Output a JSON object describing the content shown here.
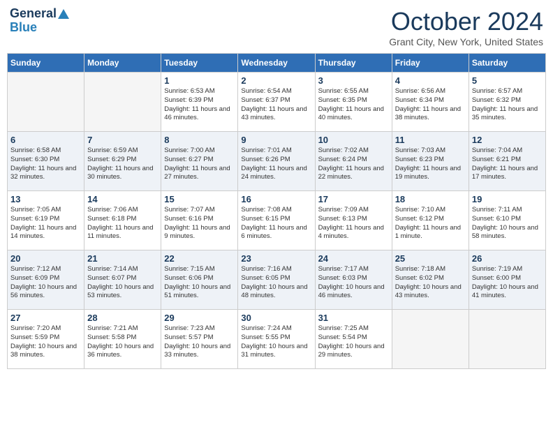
{
  "header": {
    "logo_general": "General",
    "logo_blue": "Blue",
    "month": "October 2024",
    "location": "Grant City, New York, United States"
  },
  "days_of_week": [
    "Sunday",
    "Monday",
    "Tuesday",
    "Wednesday",
    "Thursday",
    "Friday",
    "Saturday"
  ],
  "weeks": [
    [
      {
        "day": "",
        "content": ""
      },
      {
        "day": "",
        "content": ""
      },
      {
        "day": "1",
        "content": "Sunrise: 6:53 AM\nSunset: 6:39 PM\nDaylight: 11 hours and 46 minutes."
      },
      {
        "day": "2",
        "content": "Sunrise: 6:54 AM\nSunset: 6:37 PM\nDaylight: 11 hours and 43 minutes."
      },
      {
        "day": "3",
        "content": "Sunrise: 6:55 AM\nSunset: 6:35 PM\nDaylight: 11 hours and 40 minutes."
      },
      {
        "day": "4",
        "content": "Sunrise: 6:56 AM\nSunset: 6:34 PM\nDaylight: 11 hours and 38 minutes."
      },
      {
        "day": "5",
        "content": "Sunrise: 6:57 AM\nSunset: 6:32 PM\nDaylight: 11 hours and 35 minutes."
      }
    ],
    [
      {
        "day": "6",
        "content": "Sunrise: 6:58 AM\nSunset: 6:30 PM\nDaylight: 11 hours and 32 minutes."
      },
      {
        "day": "7",
        "content": "Sunrise: 6:59 AM\nSunset: 6:29 PM\nDaylight: 11 hours and 30 minutes."
      },
      {
        "day": "8",
        "content": "Sunrise: 7:00 AM\nSunset: 6:27 PM\nDaylight: 11 hours and 27 minutes."
      },
      {
        "day": "9",
        "content": "Sunrise: 7:01 AM\nSunset: 6:26 PM\nDaylight: 11 hours and 24 minutes."
      },
      {
        "day": "10",
        "content": "Sunrise: 7:02 AM\nSunset: 6:24 PM\nDaylight: 11 hours and 22 minutes."
      },
      {
        "day": "11",
        "content": "Sunrise: 7:03 AM\nSunset: 6:23 PM\nDaylight: 11 hours and 19 minutes."
      },
      {
        "day": "12",
        "content": "Sunrise: 7:04 AM\nSunset: 6:21 PM\nDaylight: 11 hours and 17 minutes."
      }
    ],
    [
      {
        "day": "13",
        "content": "Sunrise: 7:05 AM\nSunset: 6:19 PM\nDaylight: 11 hours and 14 minutes."
      },
      {
        "day": "14",
        "content": "Sunrise: 7:06 AM\nSunset: 6:18 PM\nDaylight: 11 hours and 11 minutes."
      },
      {
        "day": "15",
        "content": "Sunrise: 7:07 AM\nSunset: 6:16 PM\nDaylight: 11 hours and 9 minutes."
      },
      {
        "day": "16",
        "content": "Sunrise: 7:08 AM\nSunset: 6:15 PM\nDaylight: 11 hours and 6 minutes."
      },
      {
        "day": "17",
        "content": "Sunrise: 7:09 AM\nSunset: 6:13 PM\nDaylight: 11 hours and 4 minutes."
      },
      {
        "day": "18",
        "content": "Sunrise: 7:10 AM\nSunset: 6:12 PM\nDaylight: 11 hours and 1 minute."
      },
      {
        "day": "19",
        "content": "Sunrise: 7:11 AM\nSunset: 6:10 PM\nDaylight: 10 hours and 58 minutes."
      }
    ],
    [
      {
        "day": "20",
        "content": "Sunrise: 7:12 AM\nSunset: 6:09 PM\nDaylight: 10 hours and 56 minutes."
      },
      {
        "day": "21",
        "content": "Sunrise: 7:14 AM\nSunset: 6:07 PM\nDaylight: 10 hours and 53 minutes."
      },
      {
        "day": "22",
        "content": "Sunrise: 7:15 AM\nSunset: 6:06 PM\nDaylight: 10 hours and 51 minutes."
      },
      {
        "day": "23",
        "content": "Sunrise: 7:16 AM\nSunset: 6:05 PM\nDaylight: 10 hours and 48 minutes."
      },
      {
        "day": "24",
        "content": "Sunrise: 7:17 AM\nSunset: 6:03 PM\nDaylight: 10 hours and 46 minutes."
      },
      {
        "day": "25",
        "content": "Sunrise: 7:18 AM\nSunset: 6:02 PM\nDaylight: 10 hours and 43 minutes."
      },
      {
        "day": "26",
        "content": "Sunrise: 7:19 AM\nSunset: 6:00 PM\nDaylight: 10 hours and 41 minutes."
      }
    ],
    [
      {
        "day": "27",
        "content": "Sunrise: 7:20 AM\nSunset: 5:59 PM\nDaylight: 10 hours and 38 minutes."
      },
      {
        "day": "28",
        "content": "Sunrise: 7:21 AM\nSunset: 5:58 PM\nDaylight: 10 hours and 36 minutes."
      },
      {
        "day": "29",
        "content": "Sunrise: 7:23 AM\nSunset: 5:57 PM\nDaylight: 10 hours and 33 minutes."
      },
      {
        "day": "30",
        "content": "Sunrise: 7:24 AM\nSunset: 5:55 PM\nDaylight: 10 hours and 31 minutes."
      },
      {
        "day": "31",
        "content": "Sunrise: 7:25 AM\nSunset: 5:54 PM\nDaylight: 10 hours and 29 minutes."
      },
      {
        "day": "",
        "content": ""
      },
      {
        "day": "",
        "content": ""
      }
    ]
  ]
}
